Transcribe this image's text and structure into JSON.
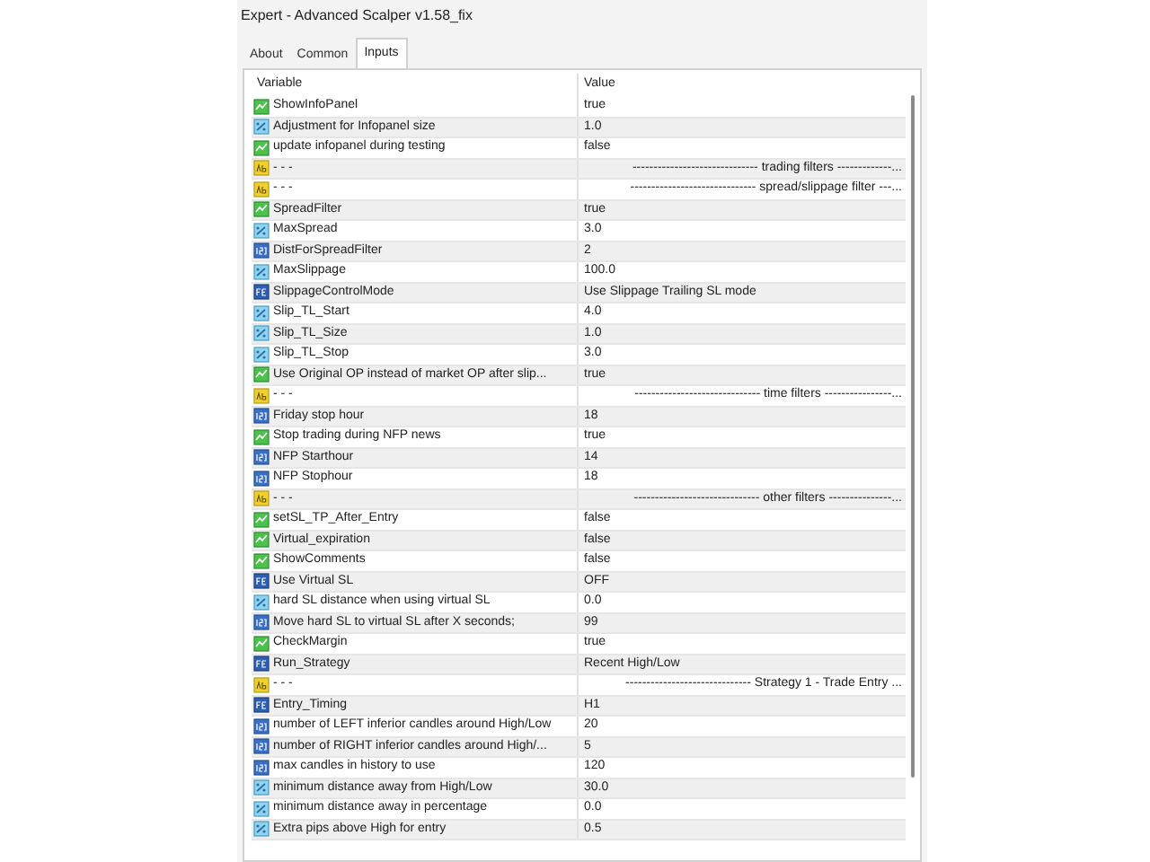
{
  "window": {
    "title": "Expert - Advanced Scalper v1.58_fix"
  },
  "tabs": [
    {
      "label": "About",
      "selected": false
    },
    {
      "label": "Common",
      "selected": false
    },
    {
      "label": "Inputs",
      "selected": true
    }
  ],
  "table": {
    "columns": [
      "Variable",
      "Value"
    ],
    "rows": [
      {
        "kind": "bool",
        "variable": "ShowInfoPanel",
        "value": "true"
      },
      {
        "kind": "double",
        "variable": "Adjustment for Infopanel size",
        "value": "1.0"
      },
      {
        "kind": "bool",
        "variable": "update infopanel during testing",
        "value": "false"
      },
      {
        "kind": "string",
        "variable": "- - -",
        "value": "------------------------------ trading filters -------------..."
      },
      {
        "kind": "string",
        "variable": "- - -",
        "value": "------------------------------ spread/slippage filter ---..."
      },
      {
        "kind": "bool",
        "variable": "SpreadFilter",
        "value": "true"
      },
      {
        "kind": "double",
        "variable": "MaxSpread",
        "value": "3.0"
      },
      {
        "kind": "int",
        "variable": "DistForSpreadFilter",
        "value": "2"
      },
      {
        "kind": "double",
        "variable": "MaxSlippage",
        "value": "100.0"
      },
      {
        "kind": "enum",
        "variable": "SlippageControlMode",
        "value": "Use Slippage Trailing SL mode"
      },
      {
        "kind": "double",
        "variable": "Slip_TL_Start",
        "value": "4.0"
      },
      {
        "kind": "double",
        "variable": "Slip_TL_Size",
        "value": "1.0"
      },
      {
        "kind": "double",
        "variable": "Slip_TL_Stop",
        "value": "3.0"
      },
      {
        "kind": "bool",
        "variable": "Use Original OP instead of market OP after slip...",
        "value": "true"
      },
      {
        "kind": "string",
        "variable": "- - -",
        "value": "------------------------------ time filters ----------------..."
      },
      {
        "kind": "int",
        "variable": "Friday stop hour",
        "value": "18"
      },
      {
        "kind": "bool",
        "variable": "Stop trading during NFP news",
        "value": "true"
      },
      {
        "kind": "int",
        "variable": "NFP Starthour",
        "value": "14"
      },
      {
        "kind": "int",
        "variable": "NFP Stophour",
        "value": "18"
      },
      {
        "kind": "string",
        "variable": "- - -",
        "value": "------------------------------ other filters ---------------..."
      },
      {
        "kind": "bool",
        "variable": "setSL_TP_After_Entry",
        "value": "false"
      },
      {
        "kind": "bool",
        "variable": "Virtual_expiration",
        "value": "false"
      },
      {
        "kind": "bool",
        "variable": "ShowComments",
        "value": "false"
      },
      {
        "kind": "enum",
        "variable": "Use Virtual SL",
        "value": "OFF"
      },
      {
        "kind": "double",
        "variable": "hard SL distance when using virtual SL",
        "value": "0.0"
      },
      {
        "kind": "int",
        "variable": "Move hard SL to virtual SL after X seconds;",
        "value": "99"
      },
      {
        "kind": "bool",
        "variable": "CheckMargin",
        "value": "true"
      },
      {
        "kind": "enum",
        "variable": "Run_Strategy",
        "value": "Recent High/Low"
      },
      {
        "kind": "string",
        "variable": "- - -",
        "value": "------------------------------ Strategy 1 - Trade Entry ..."
      },
      {
        "kind": "enum",
        "variable": "Entry_Timing",
        "value": "H1"
      },
      {
        "kind": "int",
        "variable": "number of LEFT inferior candles around High/Low",
        "value": "20"
      },
      {
        "kind": "int",
        "variable": "number of RIGHT inferior candles around High/...",
        "value": "5"
      },
      {
        "kind": "int",
        "variable": "max candles in history to use",
        "value": "120"
      },
      {
        "kind": "double",
        "variable": "minimum distance away from High/Low",
        "value": "30.0"
      },
      {
        "kind": "double",
        "variable": "minimum distance away in percentage",
        "value": "0.0"
      },
      {
        "kind": "double",
        "variable": "Extra pips above High for entry",
        "value": "0.5"
      }
    ]
  }
}
